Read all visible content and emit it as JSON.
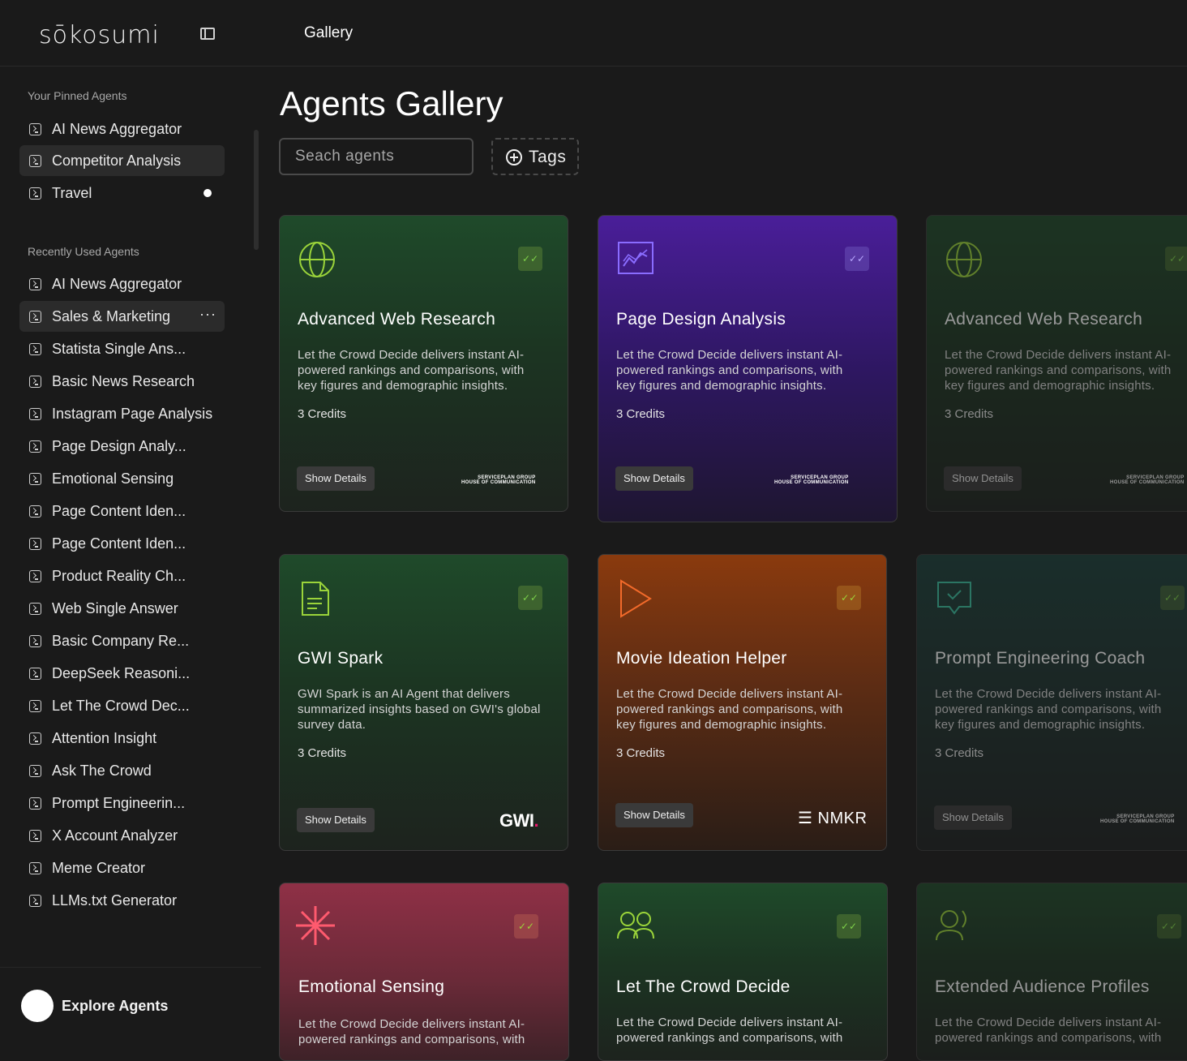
{
  "app": {
    "logo": "sōkosumi",
    "top_title": "Gallery"
  },
  "sidebar": {
    "pinned_label": "Your Pinned Agents",
    "pinned": [
      {
        "label": "AI News Aggregator"
      },
      {
        "label": "Competitor Analysis",
        "active": true
      },
      {
        "label": "Travel",
        "indicator": "unread-dot"
      }
    ],
    "recent_label": "Recently Used Agents",
    "recent": [
      {
        "label": "AI News Aggregator"
      },
      {
        "label": "Sales & Marketing",
        "more": "···"
      },
      {
        "label": "Statista Single Ans..."
      },
      {
        "label": "Basic News Research"
      },
      {
        "label": "Instagram Page Analysis"
      },
      {
        "label": "Page Design Analy..."
      },
      {
        "label": "Emotional Sensing"
      },
      {
        "label": "Page Content Iden..."
      },
      {
        "label": "Page Content Iden..."
      },
      {
        "label": "Product Reality Ch..."
      },
      {
        "label": "Web Single Answer"
      },
      {
        "label": "Basic Company Re..."
      },
      {
        "label": "DeepSeek Reasoni..."
      },
      {
        "label": "Let The Crowd Dec..."
      },
      {
        "label": "Attention Insight"
      },
      {
        "label": "Ask The Crowd"
      },
      {
        "label": "Prompt Engineerin..."
      },
      {
        "label": "X Account Analyzer"
      },
      {
        "label": "Meme Creator"
      },
      {
        "label": "LLMs.txt Generator"
      }
    ],
    "explore_label": "Explore Agents"
  },
  "main": {
    "title": "Agents Gallery",
    "search_placeholder": "Seach agents",
    "tags_label": "Tags"
  },
  "cards": [
    {
      "title": "Advanced Web Research",
      "desc": "Let the Crowd Decide delivers instant AI-powered rankings and comparisons, with key figures and demographic insights.",
      "credits": "3 Credits",
      "button": "Show Details",
      "brand_line1": "SERVICEPLAN GROUP",
      "brand_line2": "HOUSE OF COMMUNICATION",
      "icon": "globe-icon",
      "theme": "green"
    },
    {
      "title": "Page Design Analysis",
      "desc": "Let the Crowd Decide delivers instant AI-powered rankings and comparisons, with key figures and demographic insights.",
      "credits": "3 Credits",
      "button": "Show Details",
      "brand_line1": "SERVICEPLAN GROUP",
      "brand_line2": "HOUSE OF COMMUNICATION",
      "icon": "chart-line-icon",
      "theme": "purple"
    },
    {
      "title": "Advanced Web Research",
      "desc": "Let the Crowd Decide delivers instant AI-powered rankings and comparisons, with key figures and demographic insights.",
      "credits": "3 Credits",
      "button": "Show Details",
      "brand_line1": "SERVICEPLAN GROUP",
      "brand_line2": "HOUSE OF COMMUNICATION",
      "icon": "globe-icon",
      "theme": "green-faded"
    },
    {
      "title": "GWI Spark",
      "desc": "GWI Spark is an AI Agent that delivers summarized insights based on GWI's global survey data.",
      "credits": "3 Credits",
      "button": "Show Details",
      "brand": "GWI",
      "brand_dot": ".",
      "icon": "document-icon",
      "theme": "green"
    },
    {
      "title": "Movie Ideation Helper",
      "desc": "Let the Crowd Decide delivers instant AI-powered rankings and comparisons, with key figures and demographic insights.",
      "credits": "3 Credits",
      "button": "Show Details",
      "brand": "NMKR",
      "icon": "play-icon",
      "theme": "orange"
    },
    {
      "title": "Prompt Engineering Coach",
      "desc": "Let the Crowd Decide delivers instant AI-powered rankings and comparisons, with key figures and demographic insights.",
      "credits": "3 Credits",
      "button": "Show Details",
      "brand_line1": "SERVICEPLAN GROUP",
      "brand_line2": "HOUSE OF COMMUNICATION",
      "icon": "chat-check-icon",
      "theme": "teal-faded"
    },
    {
      "title": "Emotional Sensing",
      "desc": "Let the Crowd Decide delivers instant AI-powered rankings and comparisons, with",
      "icon": "asterisk-icon",
      "theme": "red"
    },
    {
      "title": "Let The Crowd Decide",
      "desc": "Let the Crowd Decide delivers instant AI-powered rankings and comparisons, with",
      "icon": "users-icon",
      "theme": "green"
    },
    {
      "title": "Extended Audience Profiles",
      "desc": "Let the Crowd Decide delivers instant AI-powered rankings and comparisons, with",
      "icon": "user-profile-icon",
      "theme": "green-faded"
    }
  ],
  "colors": {
    "accent_green": "#9bd43a",
    "accent_purple": "#8a6cff",
    "accent_orange": "#f26a2a",
    "accent_red": "#ff5a6e"
  }
}
